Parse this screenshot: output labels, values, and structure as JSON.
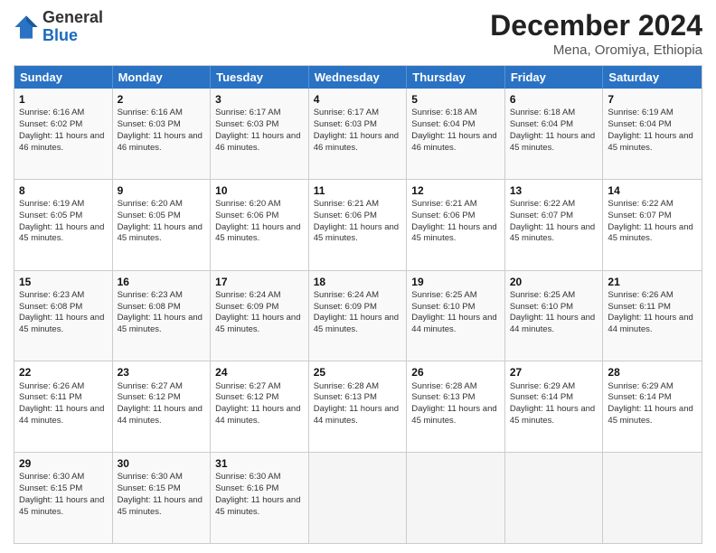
{
  "logo": {
    "general": "General",
    "blue": "Blue"
  },
  "title": "December 2024",
  "location": "Mena, Oromiya, Ethiopia",
  "days_of_week": [
    "Sunday",
    "Monday",
    "Tuesday",
    "Wednesday",
    "Thursday",
    "Friday",
    "Saturday"
  ],
  "weeks": [
    [
      {
        "day": "1",
        "sunrise": "6:16 AM",
        "sunset": "6:02 PM",
        "daylight": "11 hours and 46 minutes."
      },
      {
        "day": "2",
        "sunrise": "6:16 AM",
        "sunset": "6:03 PM",
        "daylight": "11 hours and 46 minutes."
      },
      {
        "day": "3",
        "sunrise": "6:17 AM",
        "sunset": "6:03 PM",
        "daylight": "11 hours and 46 minutes."
      },
      {
        "day": "4",
        "sunrise": "6:17 AM",
        "sunset": "6:03 PM",
        "daylight": "11 hours and 46 minutes."
      },
      {
        "day": "5",
        "sunrise": "6:18 AM",
        "sunset": "6:04 PM",
        "daylight": "11 hours and 46 minutes."
      },
      {
        "day": "6",
        "sunrise": "6:18 AM",
        "sunset": "6:04 PM",
        "daylight": "11 hours and 45 minutes."
      },
      {
        "day": "7",
        "sunrise": "6:19 AM",
        "sunset": "6:04 PM",
        "daylight": "11 hours and 45 minutes."
      }
    ],
    [
      {
        "day": "8",
        "sunrise": "6:19 AM",
        "sunset": "6:05 PM",
        "daylight": "11 hours and 45 minutes."
      },
      {
        "day": "9",
        "sunrise": "6:20 AM",
        "sunset": "6:05 PM",
        "daylight": "11 hours and 45 minutes."
      },
      {
        "day": "10",
        "sunrise": "6:20 AM",
        "sunset": "6:06 PM",
        "daylight": "11 hours and 45 minutes."
      },
      {
        "day": "11",
        "sunrise": "6:21 AM",
        "sunset": "6:06 PM",
        "daylight": "11 hours and 45 minutes."
      },
      {
        "day": "12",
        "sunrise": "6:21 AM",
        "sunset": "6:06 PM",
        "daylight": "11 hours and 45 minutes."
      },
      {
        "day": "13",
        "sunrise": "6:22 AM",
        "sunset": "6:07 PM",
        "daylight": "11 hours and 45 minutes."
      },
      {
        "day": "14",
        "sunrise": "6:22 AM",
        "sunset": "6:07 PM",
        "daylight": "11 hours and 45 minutes."
      }
    ],
    [
      {
        "day": "15",
        "sunrise": "6:23 AM",
        "sunset": "6:08 PM",
        "daylight": "11 hours and 45 minutes."
      },
      {
        "day": "16",
        "sunrise": "6:23 AM",
        "sunset": "6:08 PM",
        "daylight": "11 hours and 45 minutes."
      },
      {
        "day": "17",
        "sunrise": "6:24 AM",
        "sunset": "6:09 PM",
        "daylight": "11 hours and 45 minutes."
      },
      {
        "day": "18",
        "sunrise": "6:24 AM",
        "sunset": "6:09 PM",
        "daylight": "11 hours and 45 minutes."
      },
      {
        "day": "19",
        "sunrise": "6:25 AM",
        "sunset": "6:10 PM",
        "daylight": "11 hours and 44 minutes."
      },
      {
        "day": "20",
        "sunrise": "6:25 AM",
        "sunset": "6:10 PM",
        "daylight": "11 hours and 44 minutes."
      },
      {
        "day": "21",
        "sunrise": "6:26 AM",
        "sunset": "6:11 PM",
        "daylight": "11 hours and 44 minutes."
      }
    ],
    [
      {
        "day": "22",
        "sunrise": "6:26 AM",
        "sunset": "6:11 PM",
        "daylight": "11 hours and 44 minutes."
      },
      {
        "day": "23",
        "sunrise": "6:27 AM",
        "sunset": "6:12 PM",
        "daylight": "11 hours and 44 minutes."
      },
      {
        "day": "24",
        "sunrise": "6:27 AM",
        "sunset": "6:12 PM",
        "daylight": "11 hours and 44 minutes."
      },
      {
        "day": "25",
        "sunrise": "6:28 AM",
        "sunset": "6:13 PM",
        "daylight": "11 hours and 44 minutes."
      },
      {
        "day": "26",
        "sunrise": "6:28 AM",
        "sunset": "6:13 PM",
        "daylight": "11 hours and 45 minutes."
      },
      {
        "day": "27",
        "sunrise": "6:29 AM",
        "sunset": "6:14 PM",
        "daylight": "11 hours and 45 minutes."
      },
      {
        "day": "28",
        "sunrise": "6:29 AM",
        "sunset": "6:14 PM",
        "daylight": "11 hours and 45 minutes."
      }
    ],
    [
      {
        "day": "29",
        "sunrise": "6:30 AM",
        "sunset": "6:15 PM",
        "daylight": "11 hours and 45 minutes."
      },
      {
        "day": "30",
        "sunrise": "6:30 AM",
        "sunset": "6:15 PM",
        "daylight": "11 hours and 45 minutes."
      },
      {
        "day": "31",
        "sunrise": "6:30 AM",
        "sunset": "6:16 PM",
        "daylight": "11 hours and 45 minutes."
      },
      null,
      null,
      null,
      null
    ]
  ]
}
